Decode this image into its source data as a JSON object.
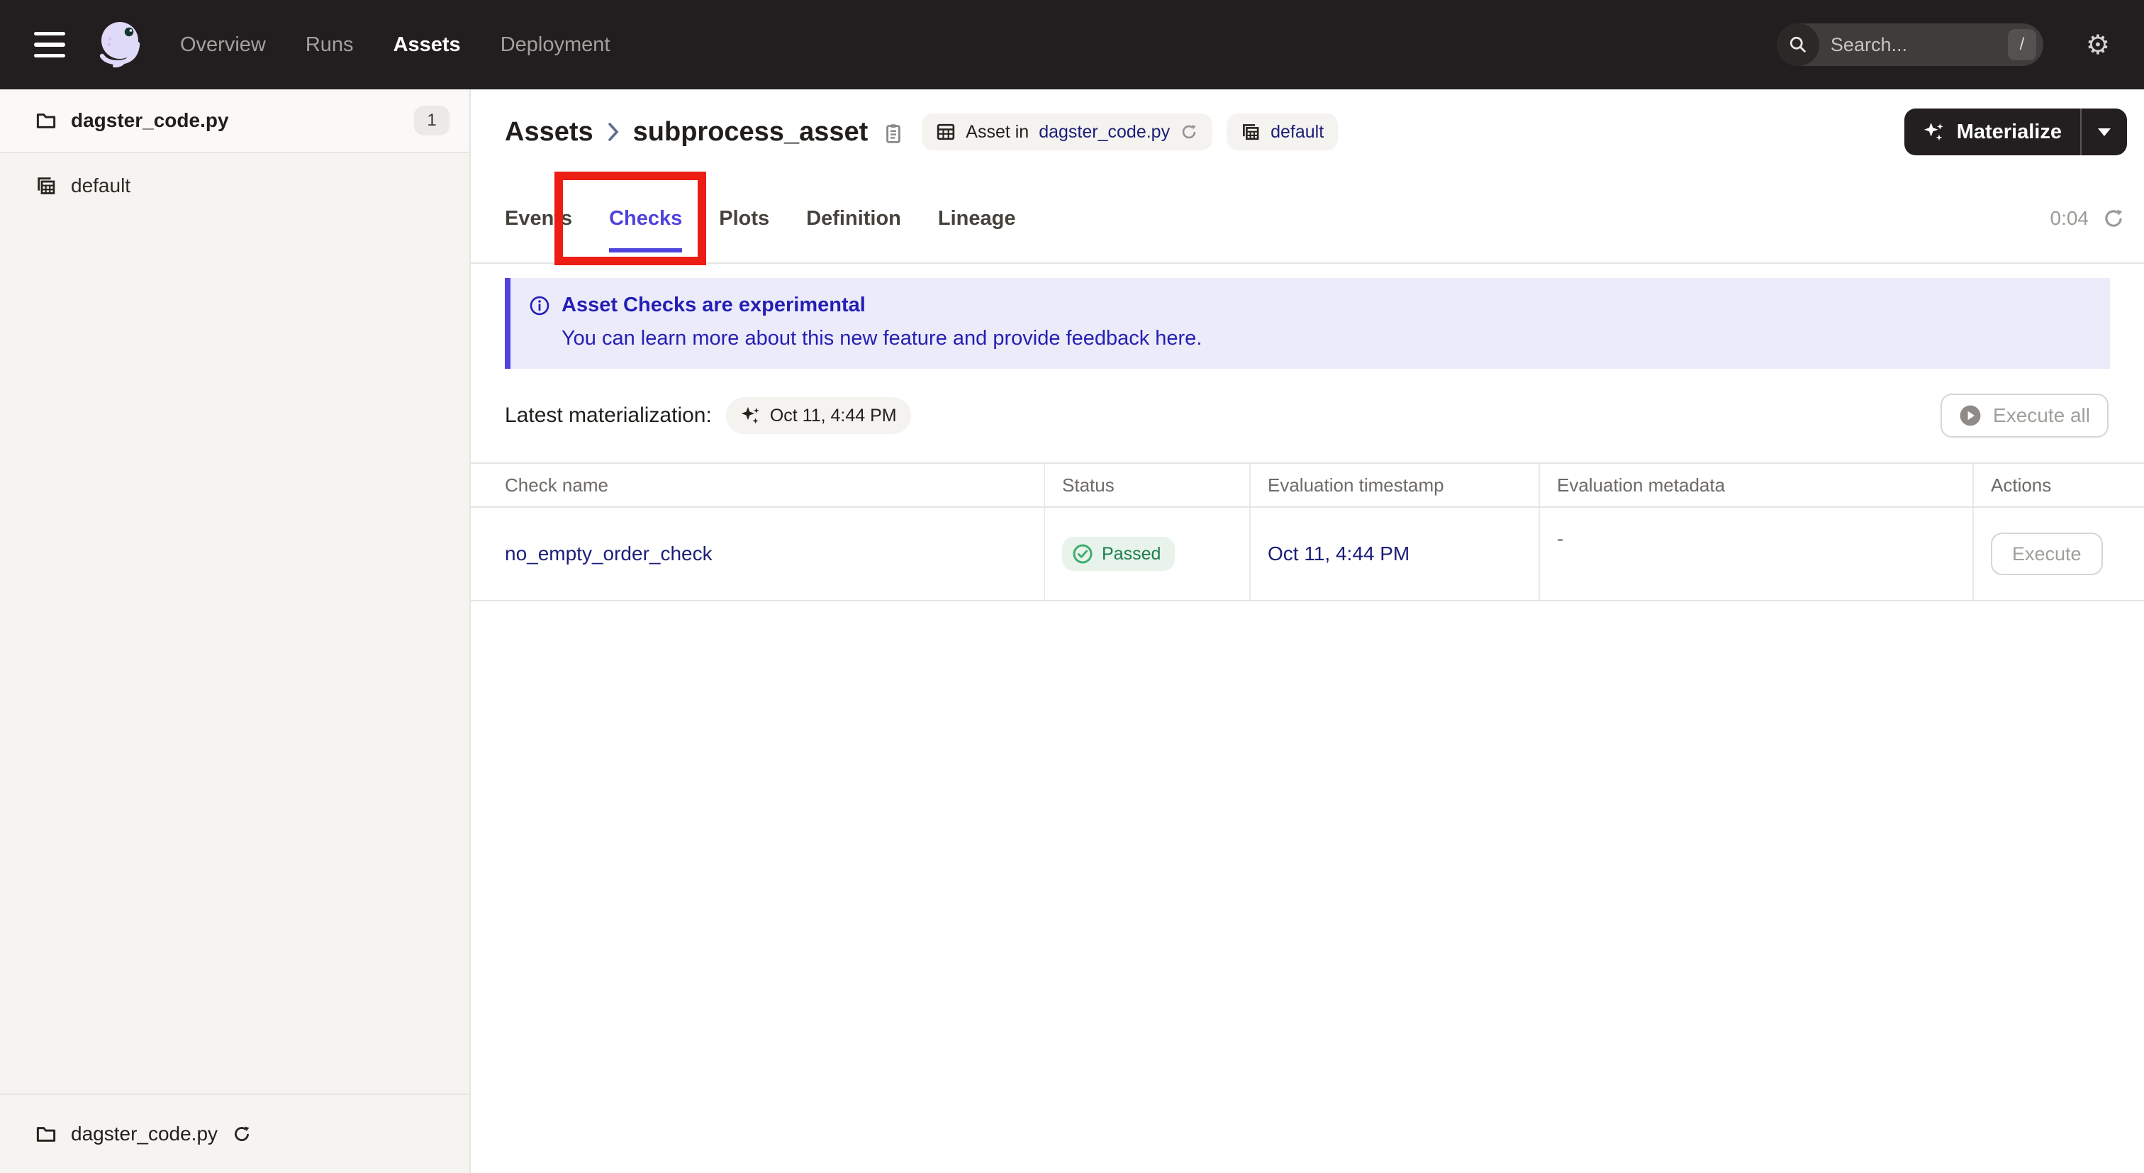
{
  "colors": {
    "accent": "#4f43dd",
    "link": "#1b1e78",
    "topnav_bg": "#221e1f",
    "sidebar_bg": "#f5f4f1",
    "border": "#e7e5e2",
    "banner_bg": "#ecebf9",
    "banner_text": "#241fb4",
    "passed_bg": "#e7f3eb",
    "passed_text": "#1e7e4d",
    "passed_icon": "#3fae70",
    "annotation": "#ec1d13"
  },
  "topnav": {
    "items": [
      {
        "label": "Overview"
      },
      {
        "label": "Runs"
      },
      {
        "label": "Assets"
      },
      {
        "label": "Deployment"
      }
    ],
    "search": {
      "placeholder": "Search...",
      "shortcut": "/"
    }
  },
  "sidebar": {
    "group": {
      "label": "dagster_code.py",
      "count": "1"
    },
    "items": [
      {
        "label": "default"
      }
    ],
    "bottom": {
      "label": "dagster_code.py"
    }
  },
  "header": {
    "breadcrumb": {
      "root": "Assets",
      "current": "subprocess_asset"
    },
    "asset_tag": {
      "prefix": "Asset in",
      "link": "dagster_code.py"
    },
    "group_tag": {
      "label": "default"
    },
    "materialize_label": "Materialize"
  },
  "tabs": {
    "items": [
      {
        "label": "Events"
      },
      {
        "label": "Checks"
      },
      {
        "label": "Plots"
      },
      {
        "label": "Definition"
      },
      {
        "label": "Lineage"
      }
    ],
    "timer": "0:04"
  },
  "banner": {
    "title": "Asset Checks are experimental",
    "body_prefix": "You can learn more about this new feature and provide feedback ",
    "link_text": "here",
    "suffix": "."
  },
  "checks": {
    "latest_label": "Latest materialization:",
    "latest_time": "Oct 11, 4:44 PM",
    "execute_all_label": "Execute all",
    "table": {
      "columns": [
        "Check name",
        "Status",
        "Evaluation timestamp",
        "Evaluation metadata",
        "Actions"
      ],
      "rows": [
        {
          "name": "no_empty_order_check",
          "status": "Passed",
          "timestamp": "Oct 11, 4:44 PM",
          "metadata": "-",
          "action": "Execute"
        }
      ]
    }
  }
}
